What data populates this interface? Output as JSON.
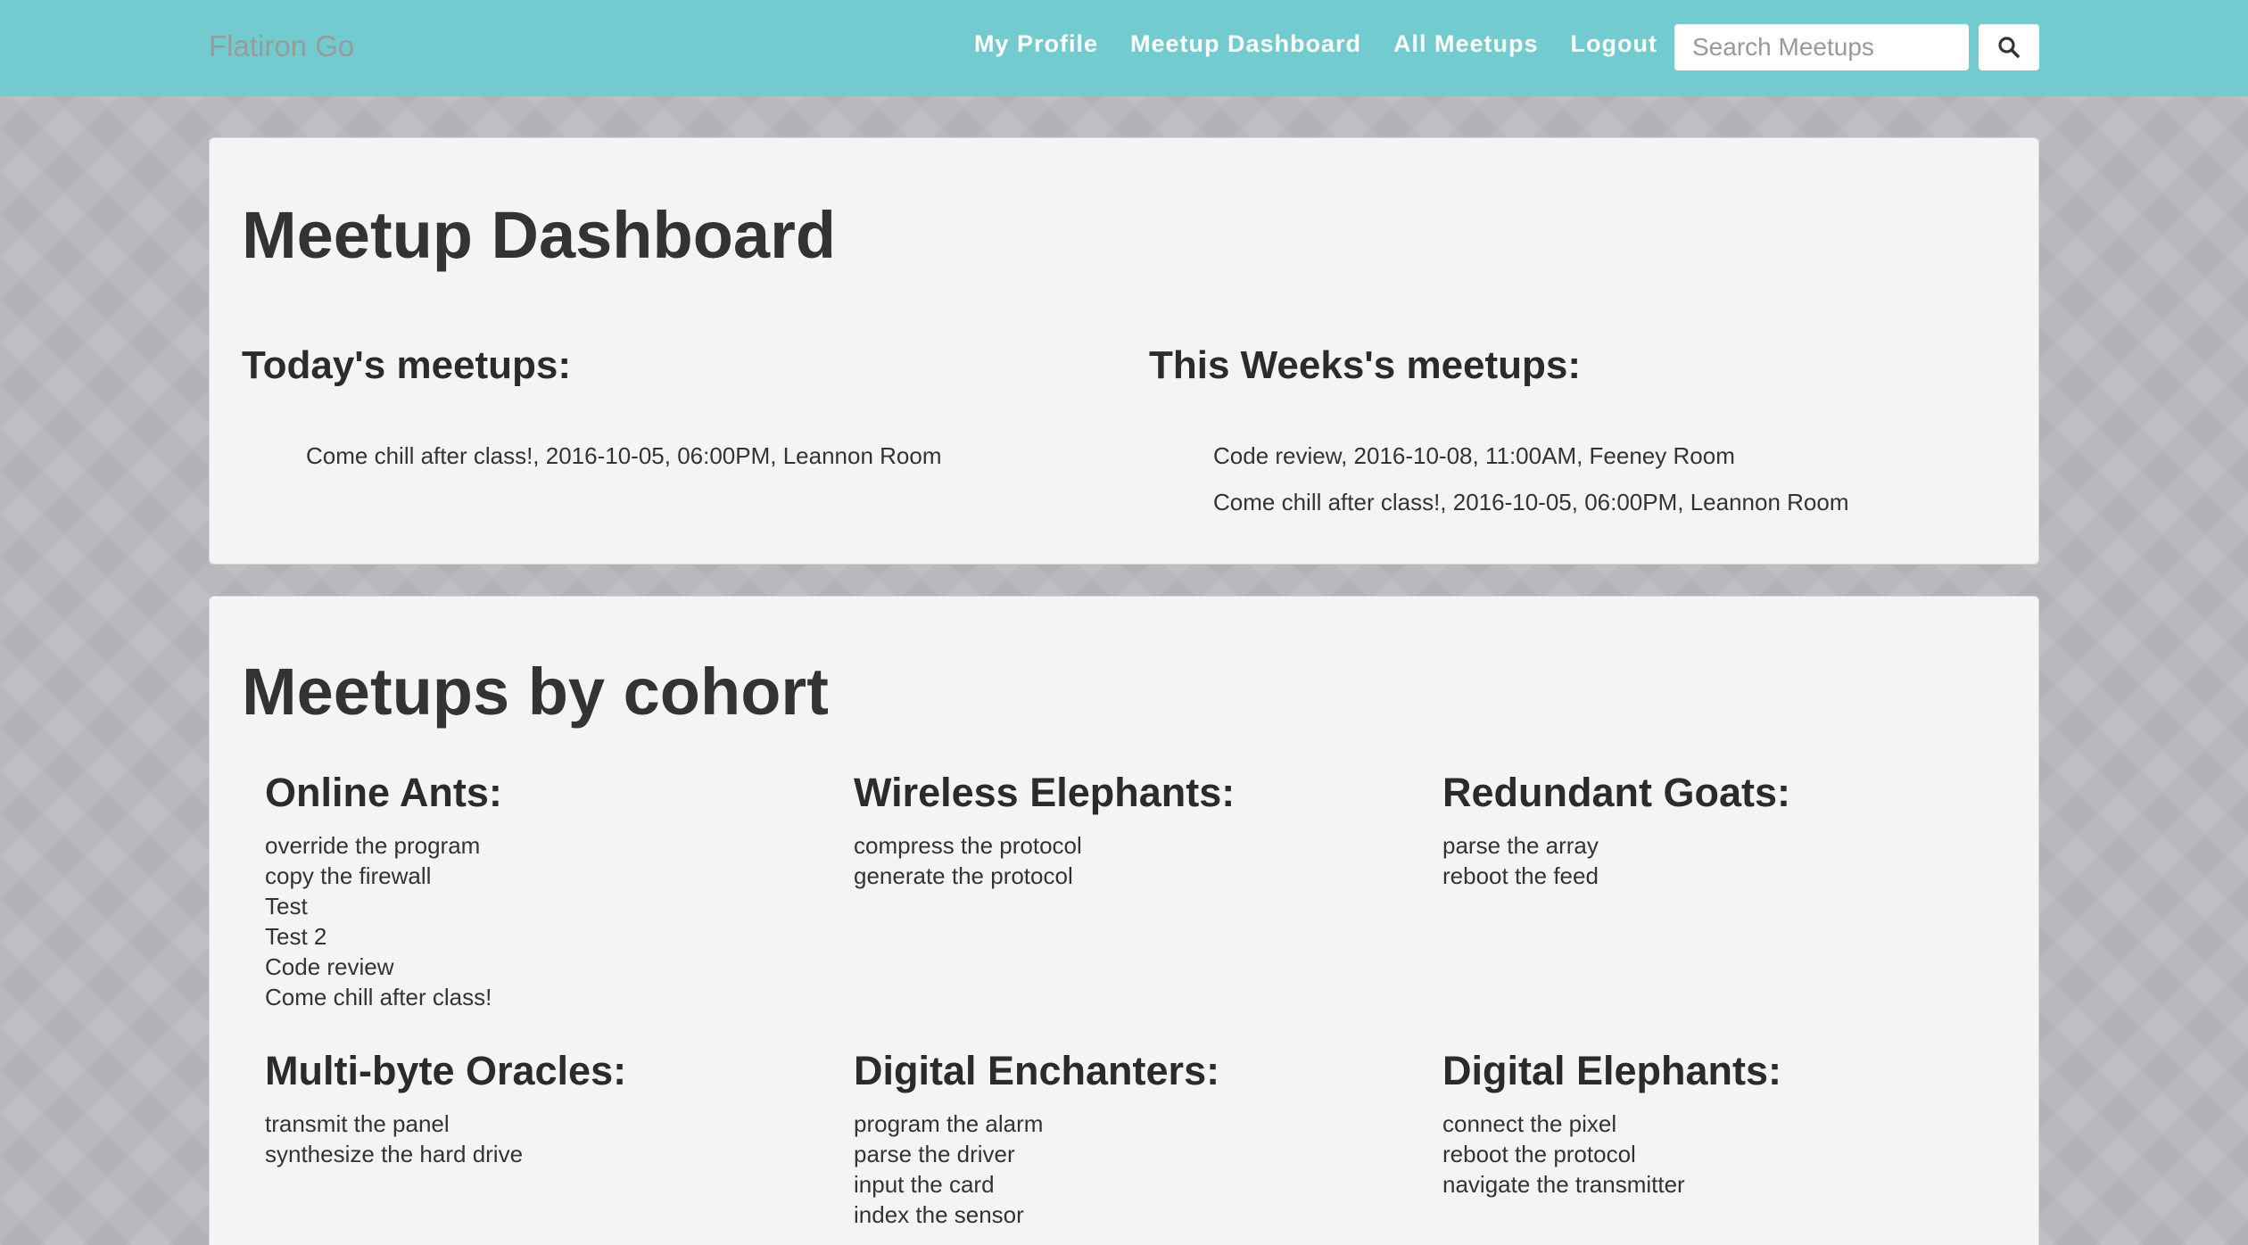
{
  "navbar": {
    "brand": "Flatiron Go",
    "links": [
      "My Profile",
      "Meetup Dashboard",
      "All Meetups",
      "Logout"
    ],
    "search_placeholder": "Search Meetups",
    "search_value": "",
    "search_icon": "search-icon",
    "color": "#72cbcf"
  },
  "dashboard": {
    "title": "Meetup Dashboard",
    "today": {
      "heading": "Today's meetups:",
      "items": [
        "Come chill after class!, 2016-10-05, 06:00PM, Leannon Room"
      ]
    },
    "week": {
      "heading": "This Weeks's meetups:",
      "items": [
        "Code review, 2016-10-08, 11:00AM, Feeney Room",
        "Come chill after class!, 2016-10-05, 06:00PM, Leannon Room"
      ]
    }
  },
  "cohorts": {
    "title": "Meetups by cohort",
    "list": [
      {
        "name": "Online Ants:",
        "meetups": [
          "override the program",
          "copy the firewall",
          "Test",
          "Test 2",
          "Code review",
          "Come chill after class!"
        ]
      },
      {
        "name": "Wireless Elephants:",
        "meetups": [
          "compress the protocol",
          "generate the protocol"
        ]
      },
      {
        "name": "Redundant Goats:",
        "meetups": [
          "parse the array",
          "reboot the feed"
        ]
      },
      {
        "name": "Multi-byte Oracles:",
        "meetups": [
          "transmit the panel",
          "synthesize the hard drive"
        ]
      },
      {
        "name": "Digital Enchanters:",
        "meetups": [
          "program the alarm",
          "parse the driver",
          "input the card",
          "index the sensor"
        ]
      },
      {
        "name": "Digital Elephants:",
        "meetups": [
          "connect the pixel",
          "reboot the protocol",
          "navigate the transmitter"
        ]
      }
    ]
  }
}
